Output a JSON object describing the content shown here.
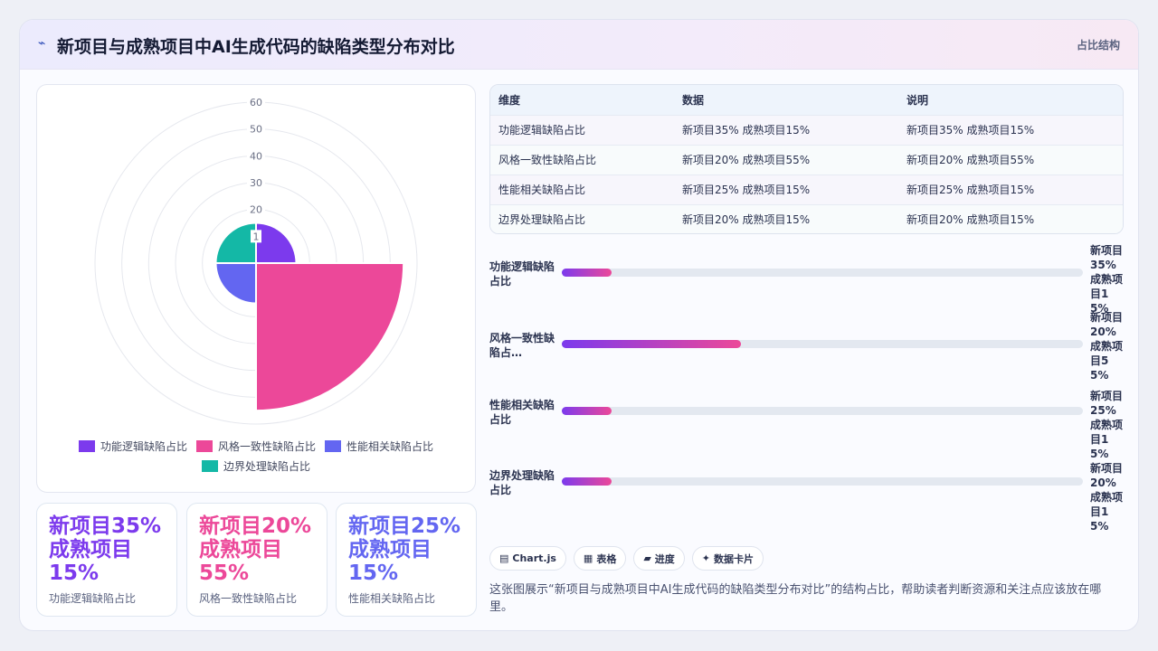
{
  "header": {
    "logo_icon": "spark-icon",
    "title": "新项目与成熟项目中AI生成代码的缺陷类型分布对比",
    "tag": "占比结构"
  },
  "chart_data": {
    "type": "polarArea",
    "title": "",
    "categories": [
      "功能逻辑缺陷占比",
      "风格一致性缺陷占比",
      "性能相关缺陷占比",
      "边界处理缺陷占比"
    ],
    "values": [
      15,
      55,
      15,
      15
    ],
    "colors": [
      "#7c3aed",
      "#ec4899",
      "#6366f1",
      "#14b8a6"
    ],
    "r_ticks": [
      "1",
      "20",
      "30",
      "40",
      "50",
      "60"
    ],
    "rlim": [
      0,
      60
    ],
    "grid": true,
    "legend_position": "bottom"
  },
  "stats": [
    {
      "value": "新项目35% 成熟项目15%",
      "label": "功能逻辑缺陷占比",
      "color": "#7c3aed"
    },
    {
      "value": "新项目20% 成熟项目55%",
      "label": "风格一致性缺陷占比",
      "color": "#ec4899"
    },
    {
      "value": "新项目25% 成熟项目15%",
      "label": "性能相关缺陷占比",
      "color": "#6366f1"
    }
  ],
  "table": {
    "headers": [
      "维度",
      "数据",
      "说明"
    ],
    "rows": [
      [
        "功能逻辑缺陷占比",
        "新项目35% 成熟项目15%",
        "新项目35% 成熟项目15%"
      ],
      [
        "风格一致性缺陷占比",
        "新项目20% 成熟项目55%",
        "新项目20% 成熟项目55%"
      ],
      [
        "性能相关缺陷占比",
        "新项目25% 成熟项目15%",
        "新项目25% 成熟项目15%"
      ],
      [
        "边界处理缺陷占比",
        "新项目20% 成熟项目15%",
        "新项目20% 成熟项目15%"
      ]
    ]
  },
  "progress": [
    {
      "label": "功能逻辑缺陷占比",
      "value": "新项目35% 成熟项目15%",
      "fill": 0.095
    },
    {
      "label": "风格一致性缺陷占比",
      "value": "新项目20% 成熟项目55%",
      "fill": 0.343
    },
    {
      "label": "性能相关缺陷占比",
      "value": "新项目25% 成熟项目15%",
      "fill": 0.095
    },
    {
      "label": "边界处理缺陷占比",
      "value": "新项目20% 成熟项目15%",
      "fill": 0.095
    }
  ],
  "chips": [
    {
      "icon": "chart-icon",
      "label": "Chart.js"
    },
    {
      "icon": "table-icon",
      "label": "表格"
    },
    {
      "icon": "progress-icon",
      "label": "进度"
    },
    {
      "icon": "sparkle-icon",
      "label": "数据卡片"
    }
  ],
  "description": "这张图展示“新项目与成熟项目中AI生成代码的缺陷类型分布对比”的结构占比，帮助读者判断资源和关注点应该放在哪里。"
}
